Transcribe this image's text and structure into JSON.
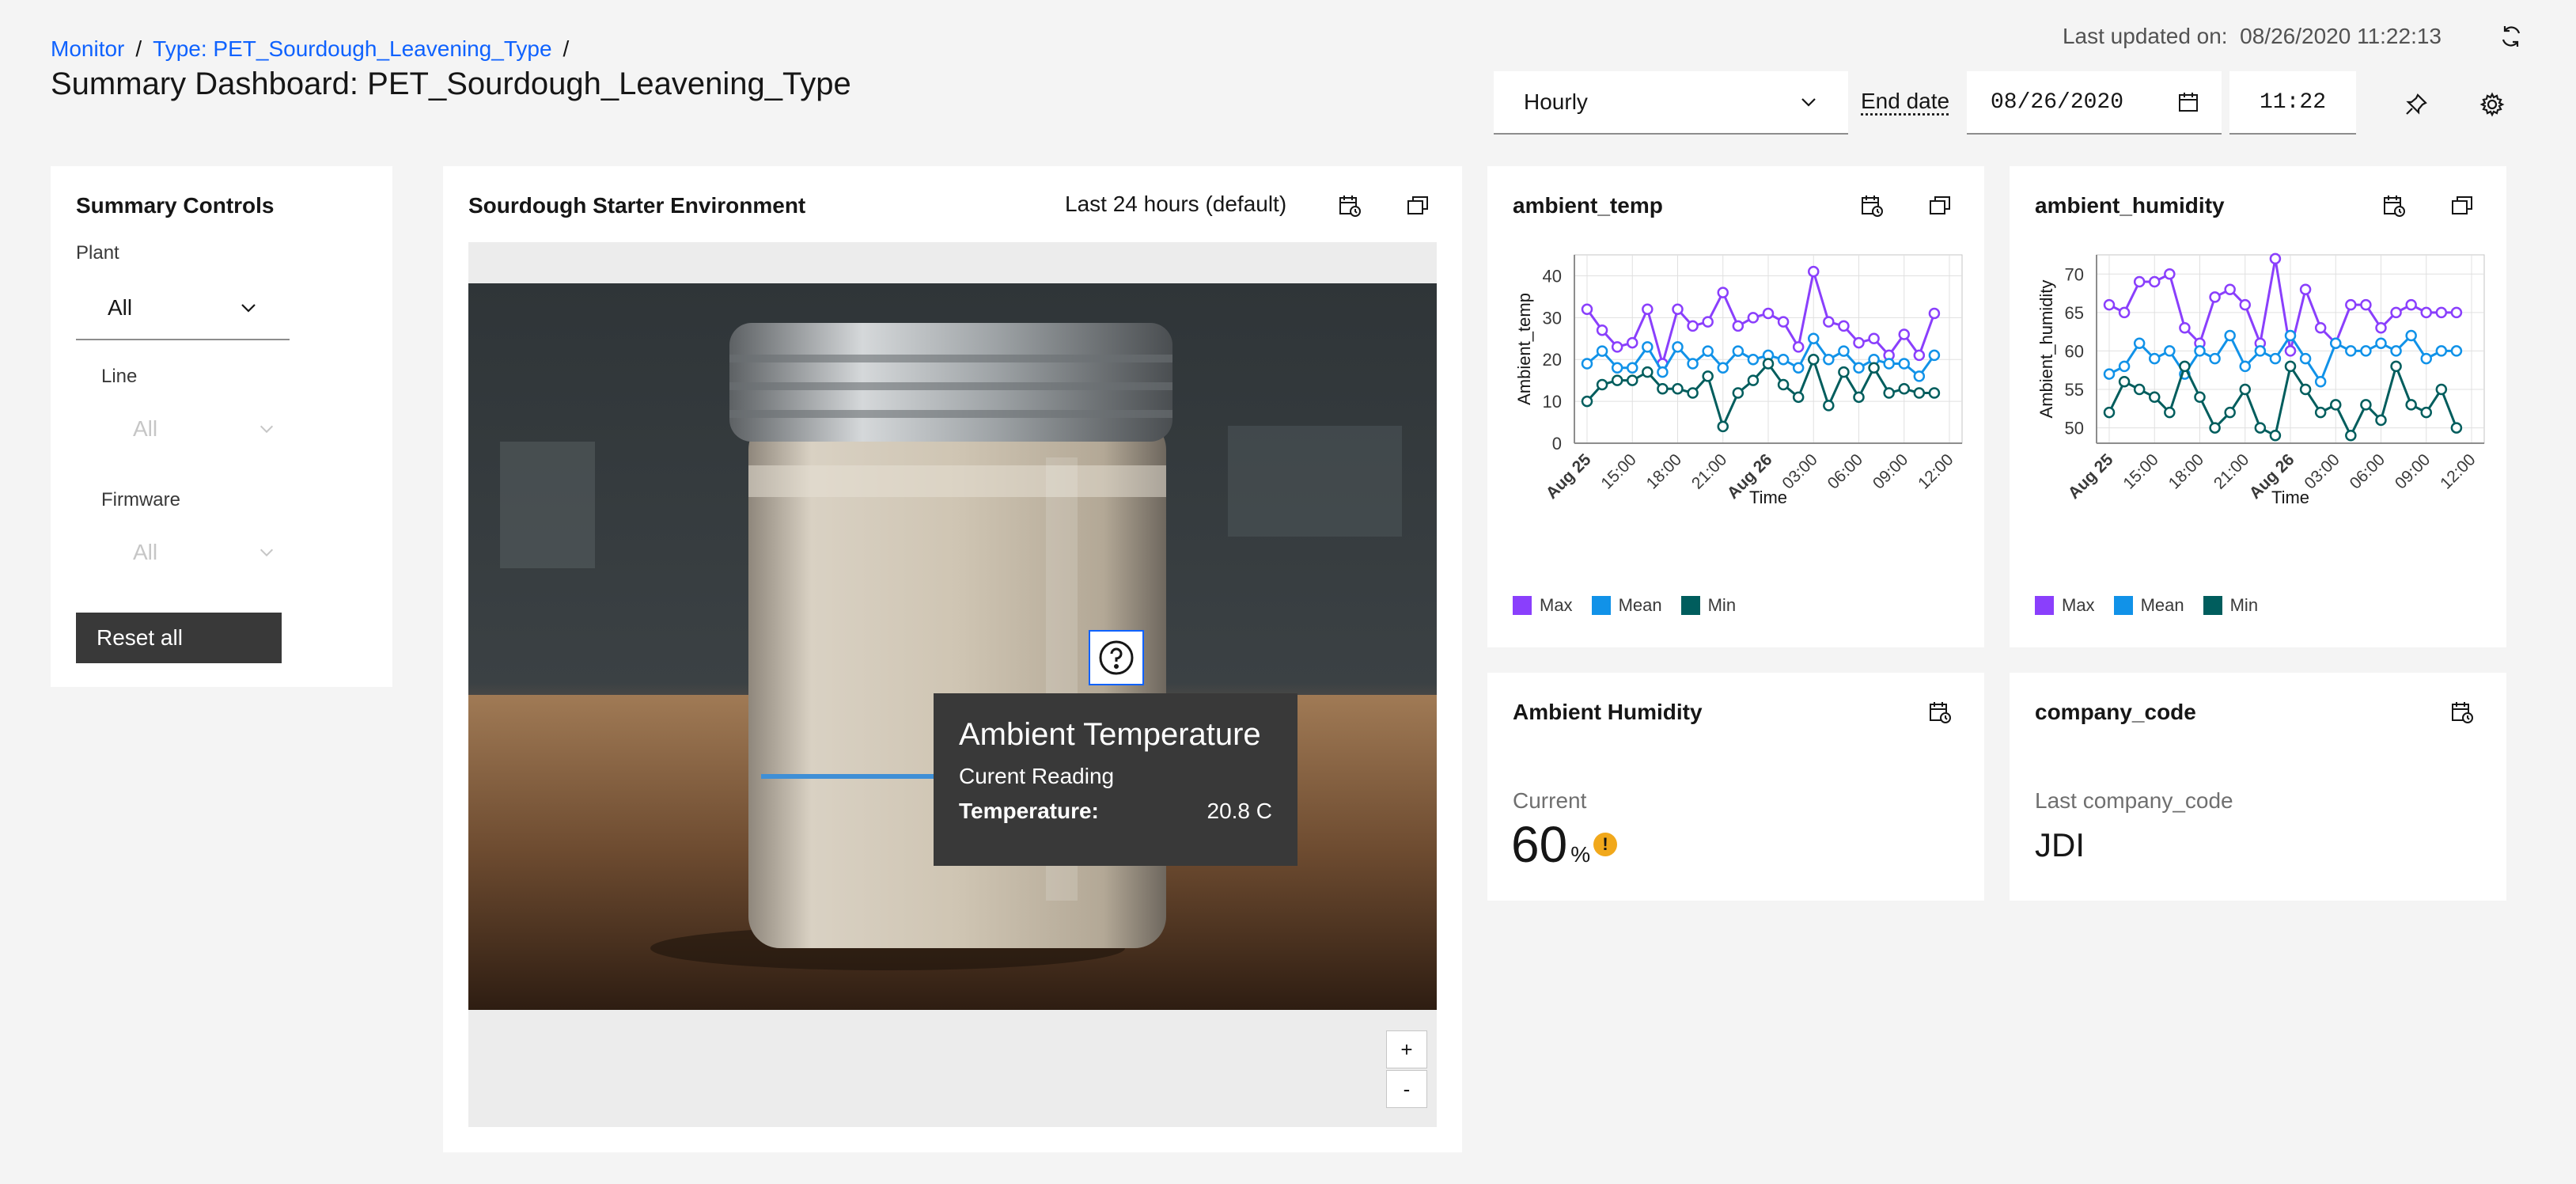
{
  "breadcrumb": {
    "monitor": "Monitor",
    "type": "Type: PET_Sourdough_Leavening_Type",
    "sep": "/"
  },
  "page_title": "Summary Dashboard: PET_Sourdough_Leavening_Type",
  "last_updated": {
    "label": "Last updated on:",
    "value": "08/26/2020 11:22:13"
  },
  "toolbar": {
    "interval": "Hourly",
    "end_date_label": "End date",
    "end_date": "08/26/2020",
    "time": "11:22"
  },
  "controls": {
    "title": "Summary Controls",
    "plant_label": "Plant",
    "plant_value": "All",
    "line_label": "Line",
    "line_value": "All",
    "firmware_label": "Firmware",
    "firmware_value": "All",
    "reset_label": "Reset all"
  },
  "image_card": {
    "title": "Sourdough Starter Environment",
    "range": "Last 24 hours (default)",
    "hotspot_icon": "help-icon",
    "tooltip": {
      "title": "Ambient Temperature",
      "subtitle": "Curent Reading",
      "field_label": "Temperature:",
      "field_value": "20.8 C"
    },
    "zoom_in": "+",
    "zoom_out": "-"
  },
  "temp_card": {
    "title": "ambient_temp"
  },
  "humidity_card": {
    "title": "ambient_humidity"
  },
  "humidity_value_card": {
    "title": "Ambient Humidity",
    "label": "Current",
    "value": "60",
    "unit": "%"
  },
  "company_card": {
    "title": "company_code",
    "label": "Last company_code",
    "value": "JDI"
  },
  "legend": {
    "max": "Max",
    "mean": "Mean",
    "min": "Min"
  },
  "colors": {
    "max": "#8a3ffc",
    "mean": "#1192e8",
    "min": "#005d5d",
    "accent": "#0f62fe",
    "warning": "#f1c21b"
  },
  "chart_data": [
    {
      "type": "line",
      "xlabel": "Time",
      "ylabel": "Ambient_temp",
      "ylim": [
        0,
        45
      ],
      "yticks": [
        0,
        10,
        20,
        30,
        40
      ],
      "xticks": [
        "Aug 25",
        "15:00",
        "18:00",
        "21:00",
        "Aug 26",
        "03:00",
        "06:00",
        "09:00",
        "12:00"
      ],
      "x_hours": [
        0,
        1,
        2,
        3,
        4,
        5,
        6,
        7,
        8,
        9,
        10,
        11,
        12,
        13,
        14,
        15,
        16,
        17,
        18,
        19,
        20,
        21,
        22,
        23
      ],
      "grid": true,
      "legend_position": "bottom-left",
      "series": [
        {
          "name": "Max",
          "values": [
            32,
            27,
            23,
            24,
            32,
            19,
            32,
            28,
            29,
            36,
            28,
            30,
            31,
            29,
            23,
            41,
            29,
            28,
            24,
            25,
            21,
            26,
            21,
            31
          ]
        },
        {
          "name": "Mean",
          "values": [
            19,
            22,
            18,
            18,
            23,
            17,
            23,
            19,
            22,
            18,
            22,
            20,
            21,
            20,
            18,
            25,
            20,
            22,
            18,
            20,
            19,
            19,
            16,
            21
          ]
        },
        {
          "name": "Min",
          "values": [
            10,
            14,
            15,
            15,
            17,
            13,
            13,
            12,
            16,
            4,
            12,
            15,
            19,
            14,
            11,
            20,
            9,
            17,
            11,
            18,
            12,
            13,
            12,
            12
          ]
        }
      ]
    },
    {
      "type": "line",
      "xlabel": "Time",
      "ylabel": "Ambient_humidity",
      "ylim": [
        48,
        72.5
      ],
      "yticks": [
        50,
        55,
        60,
        65,
        70
      ],
      "xticks": [
        "Aug 25",
        "15:00",
        "18:00",
        "21:00",
        "Aug 26",
        "03:00",
        "06:00",
        "09:00",
        "12:00"
      ],
      "x_hours": [
        0,
        1,
        2,
        3,
        4,
        5,
        6,
        7,
        8,
        9,
        10,
        11,
        12,
        13,
        14,
        15,
        16,
        17,
        18,
        19,
        20,
        21,
        22,
        23
      ],
      "grid": true,
      "legend_position": "bottom-left",
      "series": [
        {
          "name": "Max",
          "values": [
            66,
            65,
            69,
            69,
            70,
            63,
            61,
            67,
            68,
            66,
            61,
            72,
            60,
            68,
            63,
            61,
            66,
            66,
            63,
            65,
            66,
            65,
            65,
            65
          ]
        },
        {
          "name": "Mean",
          "values": [
            57,
            58,
            61,
            59,
            60,
            57,
            60,
            59,
            62,
            58,
            60,
            59,
            62,
            59,
            56,
            61,
            60,
            60,
            61,
            60,
            62,
            59,
            60,
            60
          ]
        },
        {
          "name": "Min",
          "values": [
            52,
            56,
            55,
            54,
            52,
            58,
            54,
            50,
            52,
            55,
            50,
            49,
            58,
            55,
            52,
            53,
            49,
            53,
            51,
            58,
            53,
            52,
            55,
            50
          ]
        }
      ]
    }
  ]
}
